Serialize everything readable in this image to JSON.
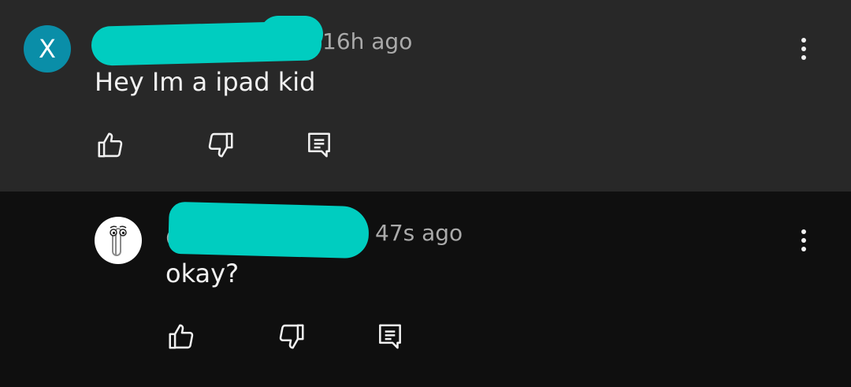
{
  "comments": [
    {
      "avatar_letter": "X",
      "avatar_color": "#0a8ea8",
      "timestamp": "16h ago",
      "text": "Hey Im a ipad kid",
      "actions": [
        "like-icon",
        "dislike-icon",
        "reply-icon"
      ],
      "menu_icon": "more-vert-icon"
    },
    {
      "avatar_icon": "paperclip-avatar-icon",
      "handle_prefix": "@",
      "timestamp": "47s ago",
      "text": "okay?",
      "actions": [
        "like-icon",
        "dislike-icon",
        "reply-icon"
      ],
      "menu_icon": "more-vert-icon"
    }
  ],
  "colors": {
    "top_bg": "#282828",
    "reply_bg": "#0f0f0f",
    "redaction": "#00cdc0",
    "text": "#f1f1f1",
    "muted": "#aaaaaa"
  }
}
